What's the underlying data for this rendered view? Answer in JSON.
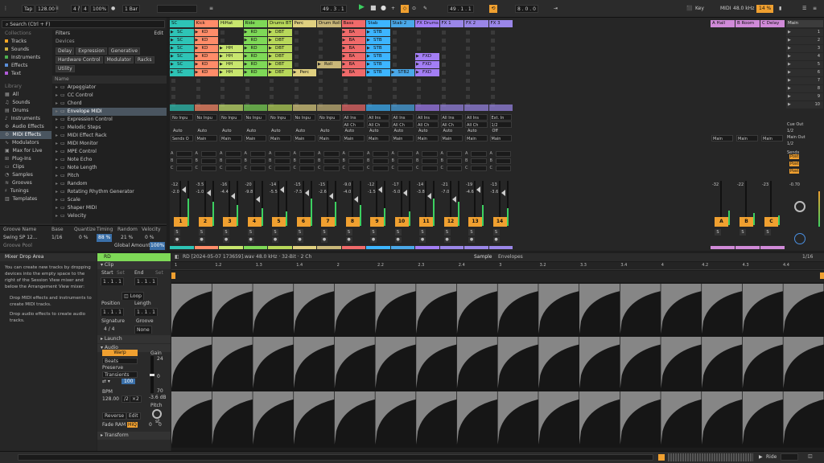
{
  "transport": {
    "tap": "Tap",
    "tempo": "128.00",
    "sig_num": "4",
    "sig_den": "4",
    "zoom": "100%",
    "quant": "1 Bar",
    "position": "49 . 3 . 1",
    "loop_start": "49 . 1 . 1",
    "loop_len": "8 . 0 . 0",
    "key": "Key",
    "midi": "MIDI",
    "sample_rate": "48.0 kHz",
    "cpu": "14 %"
  },
  "browser": {
    "search": "Search (Ctrl + F)",
    "collections_title": "Collections",
    "collections": [
      "Tracks",
      "Sounds",
      "Instruments",
      "Effects",
      "Text"
    ],
    "collection_colors": [
      "#f5a623",
      "#d0b040",
      "#4caf50",
      "#5b8fd8",
      "#b05bd8"
    ],
    "library_title": "Library",
    "library": [
      "All",
      "Sounds",
      "Drums",
      "Instruments",
      "Audio Effects",
      "MIDI Effects",
      "Modulators",
      "Max for Live",
      "Plug-Ins",
      "Clips",
      "Samples",
      "Grooves",
      "Tunings",
      "Templates"
    ],
    "filters": "Filters",
    "edit": "Edit",
    "devices": "Devices",
    "tags": [
      "Delay",
      "Expression",
      "Generative",
      "Hardware Control",
      "Modulator",
      "Racks",
      "Utility"
    ],
    "name_col": "Name",
    "items": [
      "Arpeggiator",
      "CC Control",
      "Chord",
      "Envelope MIDI",
      "Expression Control",
      "Melodic Steps",
      "MIDI Effect Rack",
      "MIDI Monitor",
      "MPE Control",
      "Note Echo",
      "Note Length",
      "Pitch",
      "Random",
      "Rotating Rhythm Generator",
      "Scale",
      "Shaper MIDI",
      "Velocity"
    ]
  },
  "groove": {
    "headers": [
      "Groove Name",
      "Base",
      "Quantize",
      "Timing",
      "Random",
      "Velocity"
    ],
    "name": "Swing SP 12...",
    "base": "1/16",
    "quantize": "0 %",
    "timing": "88 %",
    "random": "21 %",
    "velocity": "0 %",
    "pool": "Groove Pool",
    "global_label": "Global Amount",
    "global": "100%"
  },
  "tracks": [
    {
      "name": "SC",
      "color": "#2ec4b6",
      "num": "1"
    },
    {
      "name": "Kick",
      "color": "#ff8c69",
      "num": "2"
    },
    {
      "name": "HiHat",
      "color": "#c8e66e",
      "num": "3"
    },
    {
      "name": "Ride",
      "color": "#7ed957",
      "num": "4"
    },
    {
      "name": "Drums BT",
      "color": "#b8d85a",
      "num": "5"
    },
    {
      "name": "Perc",
      "color": "#e0d080",
      "num": "6"
    },
    {
      "name": "Drum Roll",
      "color": "#c9b779",
      "num": "7"
    },
    {
      "name": "Bass",
      "color": "#f06a6a",
      "num": "8"
    },
    {
      "name": "Stab",
      "color": "#3db5ff",
      "num": "9"
    },
    {
      "name": "Stab 2",
      "color": "#4aa8e8",
      "num": "10"
    },
    {
      "name": "FX Drums",
      "color": "#a37ef5",
      "num": "11"
    },
    {
      "name": "FX 1",
      "color": "#9a86e8",
      "num": "12"
    },
    {
      "name": "FX 2",
      "color": "#9a86e8",
      "num": "13"
    },
    {
      "name": "FX 3",
      "color": "#9a86e8",
      "num": "14"
    }
  ],
  "returns": [
    {
      "name": "A Hall",
      "color": "#d08ad8",
      "num": "A"
    },
    {
      "name": "B Room",
      "color": "#d08ad8",
      "num": "B"
    },
    {
      "name": "C Delay",
      "color": "#d08ad8",
      "num": "C"
    }
  ],
  "master": {
    "name": "Main",
    "scenes": [
      "1",
      "2",
      "3",
      "4",
      "5",
      "6",
      "7",
      "8",
      "9",
      "10"
    ],
    "cue_out": "Cue Out",
    "cue_val": "1/2",
    "main_out": "Main Out",
    "main_val": "1/2",
    "sends": "Sends",
    "post": "Post",
    "vol": "-0.70"
  },
  "clip_labels": {
    "sc": "SC",
    "kd": "KD",
    "hh": "HH",
    "rd": "RD",
    "dbt": "DBT",
    "perc": "Perc",
    "roll": "Roll",
    "ba": "BA",
    "stb": "STB",
    "stb2": "STB2",
    "fxd": "FXD"
  },
  "io": {
    "no_input": "No Inpu",
    "all_ins": "All Ins",
    "all_ch": "All Ch",
    "ext_in": "Ext. In",
    "auto": "Auto",
    "in": "In",
    "off": "Off",
    "main": "Main",
    "sends_only": "Sends O",
    "half": "1/2"
  },
  "mixer_vals": {
    "vol": [
      "-12",
      "-3.5",
      "-16",
      "-20",
      "-14",
      "-15",
      "-15",
      "-9.0",
      "-12",
      "-17",
      "-14",
      "-21",
      "-19",
      "-13"
    ],
    "peak": [
      "-2.0",
      "-1.0",
      "-4.4",
      "-9.8",
      "-5.5",
      "-7.5",
      "-2.6",
      "-4.0",
      "-1.5",
      "-5.0",
      "-3.8",
      "-7.0",
      "-4.6",
      "-3.6"
    ],
    "ret_vol": [
      "-32",
      "-22",
      "-23"
    ]
  },
  "detail": {
    "drop_title": "Mixer Drop Area",
    "drop_text": "You can create new tracks by dropping devices into the empty space to the right of the Session View mixer and below the Arrangement View mixer:",
    "drop_b1": "Drop MIDI effects and instruments to create MIDI tracks.",
    "drop_b2": "Drop audio effects to create audio tracks.",
    "clip_name": "RD",
    "clip": "Clip",
    "start": "Start",
    "end": "End",
    "set": "Set",
    "pos_val": "1 . 1 . 1",
    "loop": "Loop",
    "position": "Position",
    "length": "Length",
    "signature": "Signature",
    "groove": "Groove",
    "sig": "4 / 4",
    "none": "None",
    "launch": "Launch",
    "audio": "Audio",
    "warp": "Warp",
    "beats": "Beats",
    "preserve": "Preserve",
    "transients": "Transients",
    "val100": "100",
    "bpm": "BPM",
    "bpm_val": "128.00",
    "half": "/2",
    "dbl": "×2",
    "gain": "Gain",
    "g24": "24",
    "g0": "0",
    "g70": "70",
    "gdb": "-3.6 dB",
    "pitch": "Pitch",
    "st": "st",
    "reverse": "Reverse",
    "edit": "Edit",
    "fade": "Fade",
    "ram": "RAM",
    "hiq": "HiQ",
    "zero": "0",
    "transform": "Transform",
    "sample_title": "RD [2024-05-07 173659].wav  48.0 kHz · 32-Bit · 2 Ch",
    "sample": "Sample",
    "envelopes": "Envelopes",
    "zoom": "1/16",
    "ruler": [
      "1",
      "1.2",
      "1.3",
      "1.4",
      "2",
      "2.2",
      "2.3",
      "2.4",
      "3",
      "3.2",
      "3.3",
      "3.4",
      "4",
      "4.2",
      "4.3",
      "4.4"
    ]
  },
  "status": {
    "ride": "Ride"
  }
}
